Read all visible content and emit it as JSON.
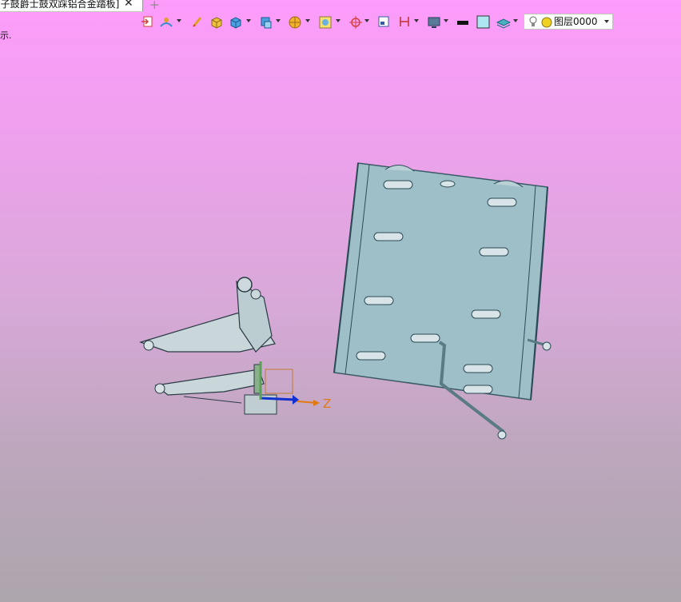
{
  "tab": {
    "title": "[子鼓爵士鼓双踩铝合金踏板]",
    "close_glyph": "✕",
    "new_glyph": "+"
  },
  "hint_text": "示.",
  "toolbar": {
    "icons": [
      "exit-icon",
      "sketch-icon",
      "pencil-icon",
      "box-icon",
      "cube-icon",
      "view-cube-icon",
      "sphere-icon",
      "render-icon",
      "snap-icon",
      "frame-icon",
      "dimension-icon",
      "display-icon",
      "color-swatch-black",
      "color-swatch-cyan",
      "layers-icon"
    ],
    "colors": {
      "swatch_black": "#111111",
      "swatch_cyan": "#aee7f2"
    },
    "layer": {
      "label": "图层0000"
    }
  },
  "viewport": {
    "axis_label": "Z",
    "colors": {
      "drum": "#9fbfc8",
      "pedal": "#c9d7da",
      "axis_z": "#e07a10",
      "axis_blue": "#1030d0",
      "axis_green": "#5aa05a"
    }
  }
}
